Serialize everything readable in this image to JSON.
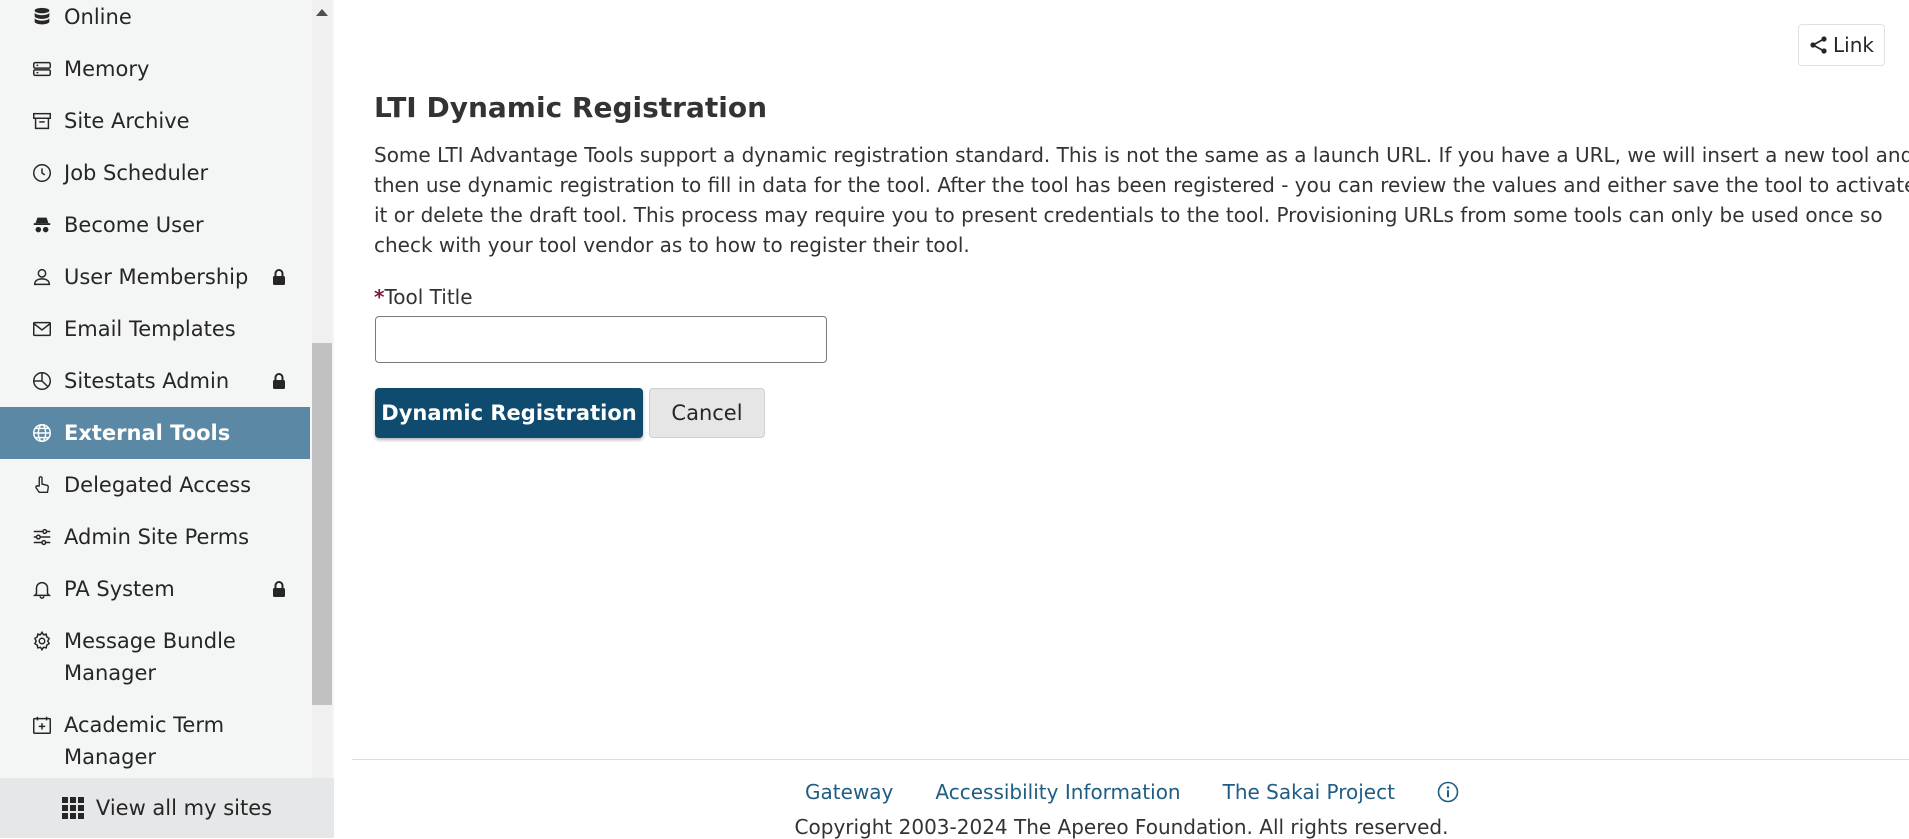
{
  "sidebar": {
    "items": [
      {
        "label": "Online",
        "icon": "database-icon",
        "locked": false
      },
      {
        "label": "Memory",
        "icon": "server-icon",
        "locked": false
      },
      {
        "label": "Site Archive",
        "icon": "archive-icon",
        "locked": false
      },
      {
        "label": "Job Scheduler",
        "icon": "clock-icon",
        "locked": false
      },
      {
        "label": "Become User",
        "icon": "incognito-icon",
        "locked": false
      },
      {
        "label": "User Membership",
        "icon": "person-icon",
        "locked": true
      },
      {
        "label": "Email Templates",
        "icon": "envelope-icon",
        "locked": false
      },
      {
        "label": "Sitestats Admin",
        "icon": "pie-chart-icon",
        "locked": true
      },
      {
        "label": "External Tools",
        "icon": "globe-icon",
        "locked": false,
        "active": true
      },
      {
        "label": "Delegated Access",
        "icon": "hand-pointer-icon",
        "locked": false
      },
      {
        "label": "Admin Site Perms",
        "icon": "sliders-icon",
        "locked": false
      },
      {
        "label": "PA System",
        "icon": "bell-icon",
        "locked": true
      },
      {
        "label": "Message Bundle Manager",
        "icon": "gear-icon",
        "locked": false
      },
      {
        "label": "Academic Term Manager",
        "icon": "calendar-plus-icon",
        "locked": false
      }
    ],
    "view_all_label": "View all my sites"
  },
  "header": {
    "link_label": "Link"
  },
  "main": {
    "title": "LTI Dynamic Registration",
    "description": "Some LTI Advantage Tools support a dynamic registration standard. This is not the same as a launch URL. If you have a URL, we will insert a new tool and then use dynamic registration to fill in data for the tool. After the tool has been registered - you can review the values and either save the tool to activate it or delete the draft tool. This process may require you to present credentials to the tool. Provisioning URLs from some tools can only be used once so check with your tool vendor as to how to register their tool.",
    "field": {
      "required_mark": "*",
      "label": "Tool Title",
      "value": ""
    },
    "buttons": {
      "register": "Dynamic Registration",
      "cancel": "Cancel"
    }
  },
  "footer": {
    "links": [
      "Gateway",
      "Accessibility Information",
      "The Sakai Project"
    ],
    "copyright": "Copyright 2003-2024 The Apereo Foundation. All rights reserved."
  },
  "colors": {
    "active_item_bg": "#5a88a5",
    "primary_button": "#0f4b6e",
    "link": "#1f5d85",
    "required": "#7b1c3a"
  }
}
